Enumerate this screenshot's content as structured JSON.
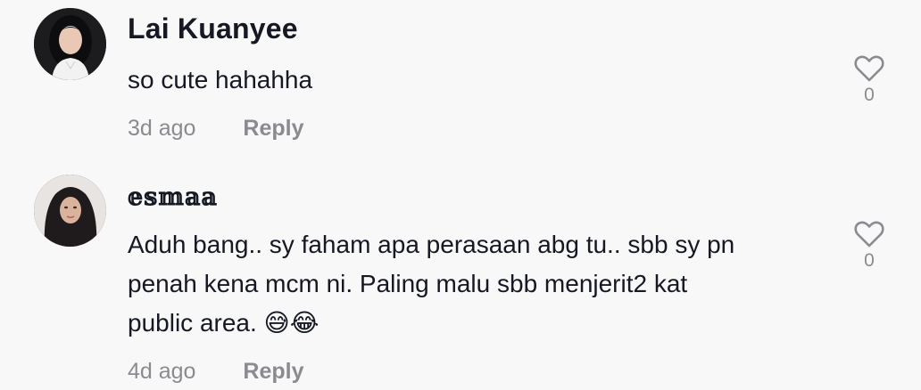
{
  "comments": [
    {
      "username": "Lai Kuanyee",
      "text_lines": [
        "so cute hahahha"
      ],
      "time": "3d ago",
      "reply_label": "Reply",
      "like_count": "0",
      "avatar_icon": "user-avatar-photo"
    },
    {
      "username": "𝕖𝕤𝕞𝕒𝕒",
      "text_lines": [
        "Aduh bang.. sy faham apa perasaan abg tu.. sbb sy pn",
        "penah kena mcm ni. Paling malu sbb menjerit2 kat",
        "public area. 😅😂"
      ],
      "time": "4d ago",
      "reply_label": "Reply",
      "like_count": "0",
      "avatar_icon": "user-avatar-photo"
    }
  ],
  "colors": {
    "background": "#f8f8f8",
    "primary_text": "#161823",
    "secondary_text": "#8a8b91"
  },
  "icons": {
    "like": "heart-outline-icon"
  }
}
